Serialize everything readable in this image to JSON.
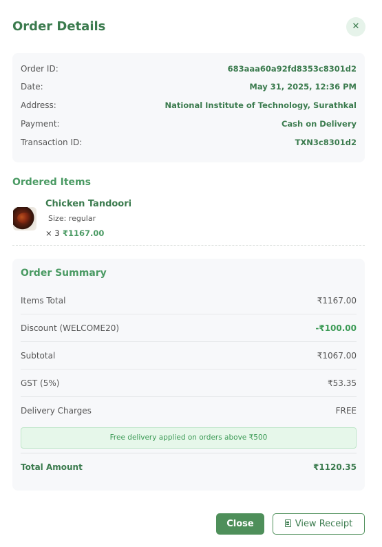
{
  "header": {
    "title": "Order Details",
    "close_icon": "✕"
  },
  "order": {
    "rows": [
      {
        "label": "Order ID:",
        "value": "683aaa60a92fd8353c8301d2"
      },
      {
        "label": "Date:",
        "value": "May 31, 2025, 12:36 PM"
      },
      {
        "label": "Address:",
        "value": "National Institute of Technology, Surathkal"
      },
      {
        "label": "Payment:",
        "value": "Cash on Delivery"
      },
      {
        "label": "Transaction ID:",
        "value": "TXN3c8301d2"
      }
    ]
  },
  "items_section": {
    "title": "Ordered Items"
  },
  "items": [
    {
      "name": "Chicken Tandoori",
      "size": "Size: regular",
      "qty": "× 3",
      "price": "₹1167.00"
    }
  ],
  "summary": {
    "title": "Order Summary",
    "rows": [
      {
        "label": "Items Total",
        "value": "₹1167.00"
      },
      {
        "label": "Discount (WELCOME20)",
        "value": "-₹100.00"
      },
      {
        "label": "Subtotal",
        "value": "₹1067.00"
      },
      {
        "label": "GST (5%)",
        "value": "₹53.35"
      },
      {
        "label": "Delivery Charges",
        "value": "FREE"
      }
    ],
    "note": "Free delivery applied on orders above ₹500",
    "total_label": "Total Amount",
    "total_value": "₹1120.35"
  },
  "footer": {
    "close_label": "Close",
    "receipt_label": "View Receipt"
  },
  "colors": {
    "primary": "#3b7b4e",
    "accent": "#4a9a63",
    "button": "#4e8f5a",
    "card_bg": "#f7f8fa"
  }
}
